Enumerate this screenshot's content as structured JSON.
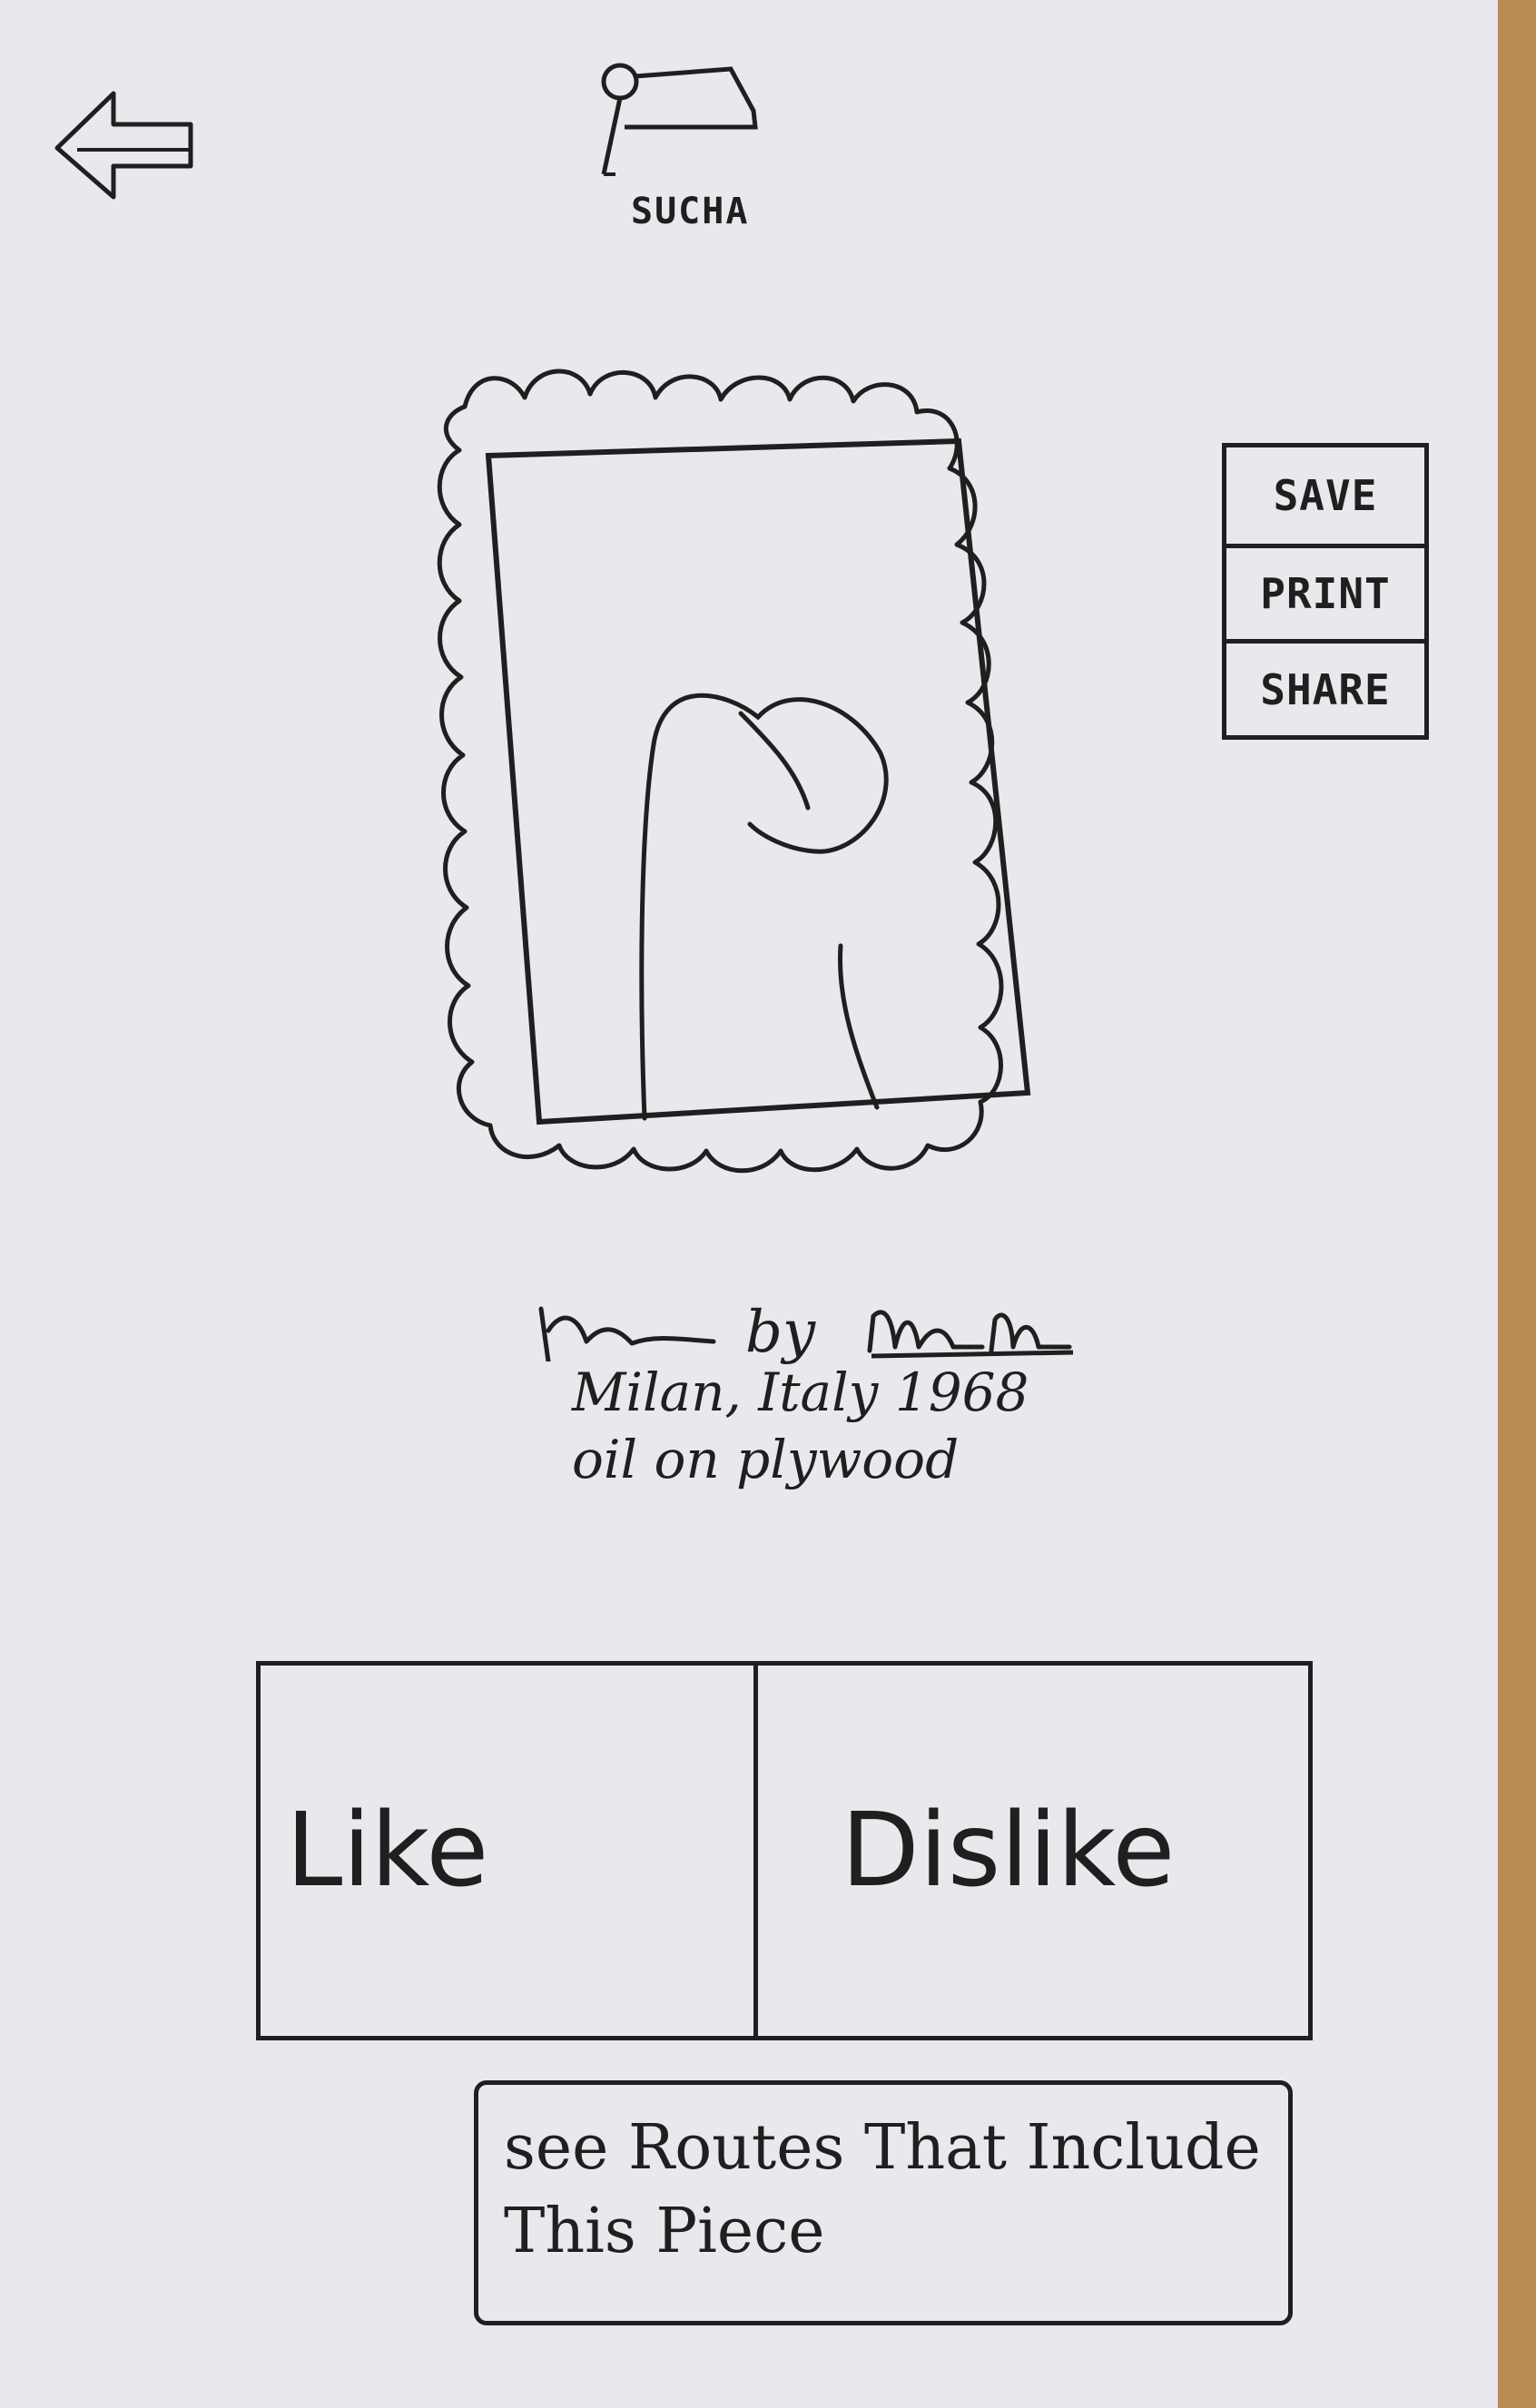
{
  "header": {
    "back_icon": "back-arrow-icon",
    "search_icon": "search-icon",
    "search_label": "SUCHA"
  },
  "artwork": {
    "title": "",
    "artist": "",
    "by_text": "by",
    "location_year": "Milan, Italy 1968",
    "medium": "oil on plywood"
  },
  "actions": {
    "save_label": "SAVE",
    "print_label": "PRINT",
    "share_label": "SHARE"
  },
  "vote": {
    "like_label": "Like",
    "dislike_label": "Dislike"
  },
  "routes": {
    "label": "see Routes That Include This Piece"
  }
}
